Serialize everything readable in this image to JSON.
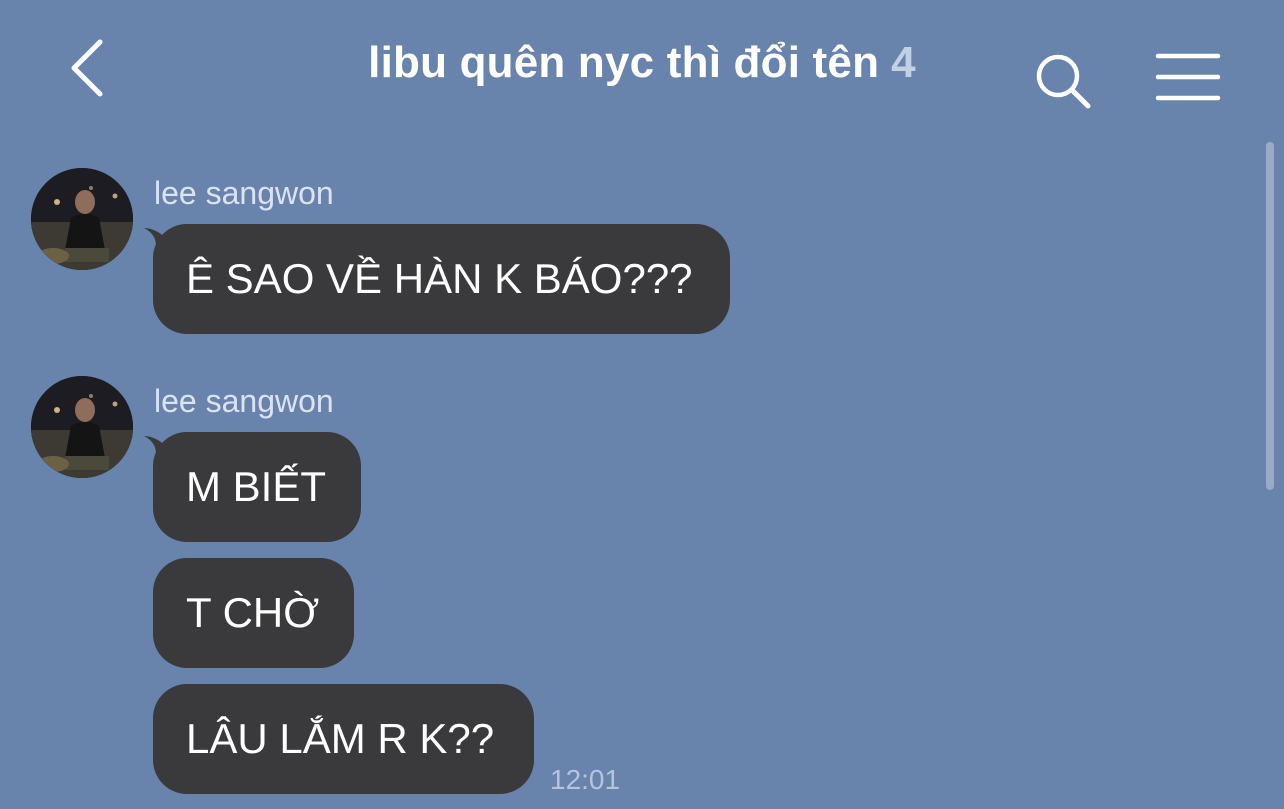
{
  "header": {
    "title": "libu quên nyc thì đổi tên",
    "member_count": "4",
    "back_icon": "chevron-left-icon",
    "search_icon": "search-icon",
    "menu_icon": "hamburger-menu-icon"
  },
  "colors": {
    "background": "#6884ad",
    "bubble": "#3a3a3d",
    "text": "#ffffff",
    "sender": "#dbe3ef",
    "time": "#b7c4d9"
  },
  "messages": [
    {
      "sender": "lee sangwon",
      "bubbles": [
        "Ê SAO VỀ HÀN K BÁO???"
      ]
    },
    {
      "sender": "lee sangwon",
      "bubbles": [
        "M BIẾT",
        "T CHỜ",
        "LÂU LẮM R K??"
      ],
      "time": "12:01"
    }
  ]
}
